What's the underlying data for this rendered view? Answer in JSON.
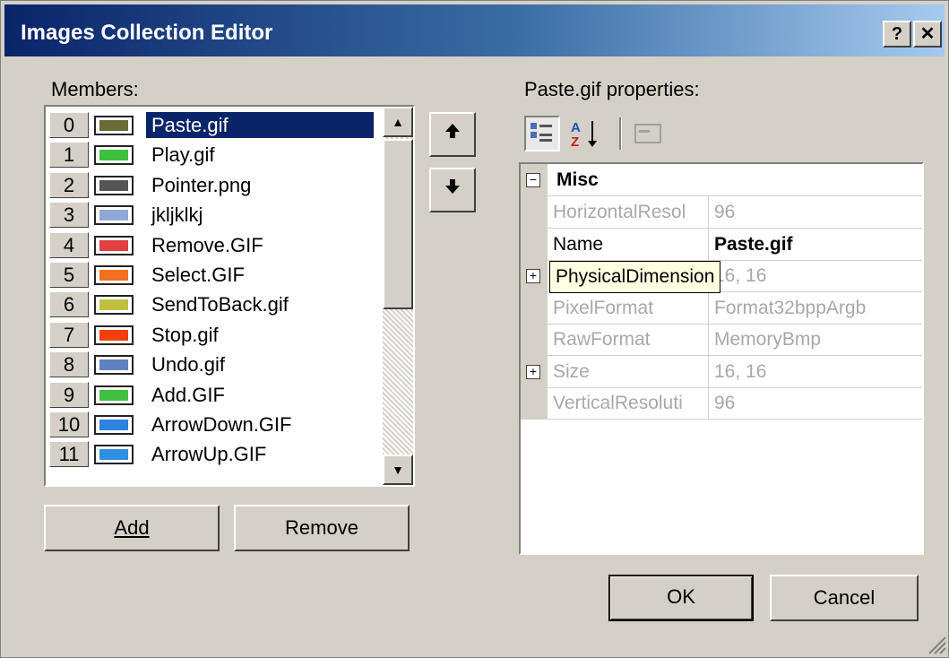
{
  "window": {
    "title": "Images Collection Editor",
    "help_glyph": "?",
    "close_glyph": "✕"
  },
  "members": {
    "label": "Members:",
    "items": [
      {
        "index": "0",
        "name": "Paste.gif",
        "color": "#6b6b3a"
      },
      {
        "index": "1",
        "name": "Play.gif",
        "color": "#3fbf3f"
      },
      {
        "index": "2",
        "name": "Pointer.png",
        "color": "#555555"
      },
      {
        "index": "3",
        "name": "jkljklkj",
        "color": "#8fa8d8"
      },
      {
        "index": "4",
        "name": "Remove.GIF",
        "color": "#e04040"
      },
      {
        "index": "5",
        "name": "Select.GIF",
        "color": "#f07020"
      },
      {
        "index": "6",
        "name": "SendToBack.gif",
        "color": "#c0c040"
      },
      {
        "index": "7",
        "name": "Stop.gif",
        "color": "#f04010"
      },
      {
        "index": "8",
        "name": "Undo.gif",
        "color": "#6080c0"
      },
      {
        "index": "9",
        "name": "Add.GIF",
        "color": "#40c040"
      },
      {
        "index": "10",
        "name": "ArrowDown.GIF",
        "color": "#3080e0"
      },
      {
        "index": "11",
        "name": "ArrowUp.GIF",
        "color": "#3090e0"
      }
    ],
    "selected_index": 0
  },
  "buttons": {
    "add": "Add",
    "remove": "Remove",
    "ok": "OK",
    "cancel": "Cancel",
    "up": "🠕",
    "down": "🠗"
  },
  "properties": {
    "label": "Paste.gif properties:",
    "category": "Misc",
    "rows": [
      {
        "name": "HorizontalResol",
        "value": "96"
      },
      {
        "name": "Name",
        "value": "Paste.gif"
      },
      {
        "name": "PhysicalDimension",
        "value": "16, 16"
      },
      {
        "name": "PixelFormat",
        "value": "Format32bppArgb"
      },
      {
        "name": "RawFormat",
        "value": "MemoryBmp"
      },
      {
        "name": "Size",
        "value": "16, 16"
      },
      {
        "name": "VerticalResoluti",
        "value": "96"
      }
    ],
    "tooltip": "PhysicalDimension"
  },
  "icons": [
    "help-icon",
    "close-icon",
    "arrow-up-icon",
    "arrow-down-icon",
    "categorized-icon",
    "alphabetical-icon",
    "property-pages-icon",
    "scroll-up-icon",
    "scroll-down-icon",
    "size-grip-icon"
  ]
}
